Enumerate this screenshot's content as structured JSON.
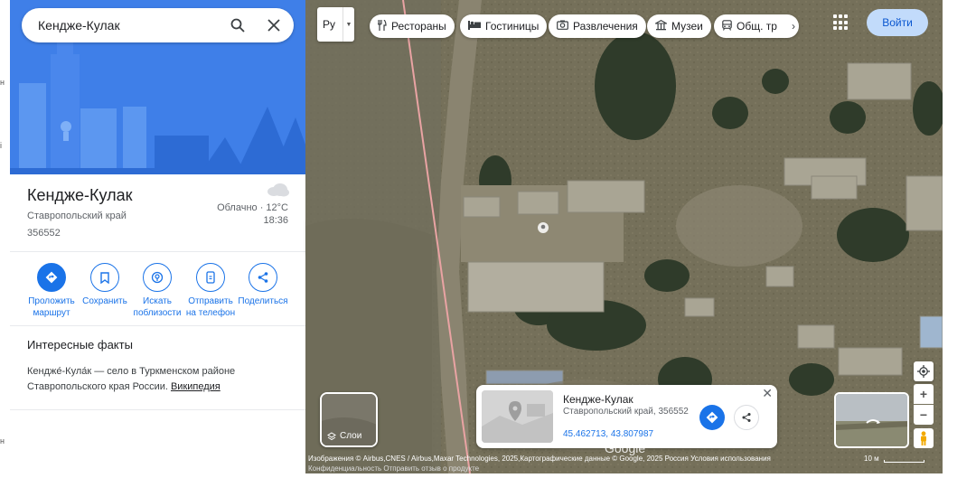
{
  "search": {
    "value": "Кендже-Кулак"
  },
  "place": {
    "title": "Кендже-Кулак",
    "region": "Ставропольский край",
    "postal": "356552",
    "weather": "Облачно · 12°C",
    "time": "18:36"
  },
  "actions": [
    {
      "label": "Проложить маршрут",
      "icon": "route-icon"
    },
    {
      "label": "Сохранить",
      "icon": "bookmark-icon"
    },
    {
      "label": "Искать поблизости",
      "icon": "nearby-icon"
    },
    {
      "label": "Отправить на телефон",
      "icon": "phone-icon"
    },
    {
      "label": "Поделиться",
      "icon": "share-icon"
    }
  ],
  "facts": {
    "title": "Интересные факты",
    "text": "Кендже́-Кула́к — село в Туркменском районе Ставропольского края России. ",
    "link": "Википедия"
  },
  "map": {
    "lang": "Ру",
    "chips": [
      {
        "label": "Рестораны",
        "icon": "restaurant-icon"
      },
      {
        "label": "Гостиницы",
        "icon": "hotel-icon"
      },
      {
        "label": "Развлечения",
        "icon": "camera-icon"
      },
      {
        "label": "Музеи",
        "icon": "museum-icon"
      },
      {
        "label": "Общ. тр",
        "icon": "transit-icon"
      }
    ],
    "signin": "Войти",
    "layers": "Слои",
    "card": {
      "title": "Кендже-Кулак",
      "subtitle": "Ставропольский край, 356552",
      "coords": "45.462713, 43.807987"
    },
    "logo": "Google",
    "attribution": "Изображения © Airbus,CNES / Airbus,Maxar Technologies, 2025,Картографические данные © Google, 2025   Россия   Условия использования",
    "footer": "Конфиденциальность   Отправить отзыв о продукте",
    "scale": "10 м"
  }
}
